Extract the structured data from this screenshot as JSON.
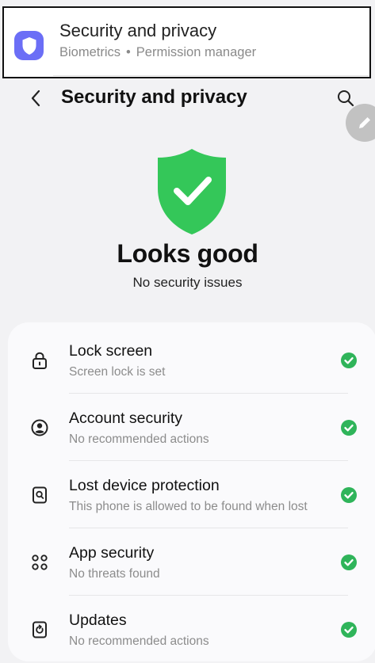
{
  "search_result": {
    "title": "Security and privacy",
    "subtitle_parts": [
      "Biometrics",
      "•",
      "Permission manager"
    ],
    "icon": "shield-icon",
    "icon_color": "#6b6ef6"
  },
  "header": {
    "back_icon": "chevron-left-icon",
    "title": "Security and privacy",
    "search_icon": "search-icon",
    "edit_icon": "pencil-icon"
  },
  "status": {
    "icon": "shield-check-icon",
    "icon_color": "#34c759",
    "title": "Looks good",
    "subtitle": "No security issues"
  },
  "items": [
    {
      "title": "Lock screen",
      "subtitle": "Screen lock is set",
      "icon": "lock-icon",
      "status_icon": "check-circle-icon"
    },
    {
      "title": "Account security",
      "subtitle": "No recommended actions",
      "icon": "account-circle-icon",
      "status_icon": "check-circle-icon"
    },
    {
      "title": "Lost device protection",
      "subtitle": "This phone is allowed to be found when lost",
      "icon": "find-device-icon",
      "status_icon": "check-circle-icon"
    },
    {
      "title": "App security",
      "subtitle": "No threats found",
      "icon": "apps-grid-icon",
      "status_icon": "check-circle-icon"
    },
    {
      "title": "Updates",
      "subtitle": "No recommended actions",
      "icon": "update-icon",
      "status_icon": "check-circle-icon"
    }
  ],
  "colors": {
    "accent_green": "#2fb45a",
    "background": "#f2f2f4",
    "card": "#fafafc"
  }
}
